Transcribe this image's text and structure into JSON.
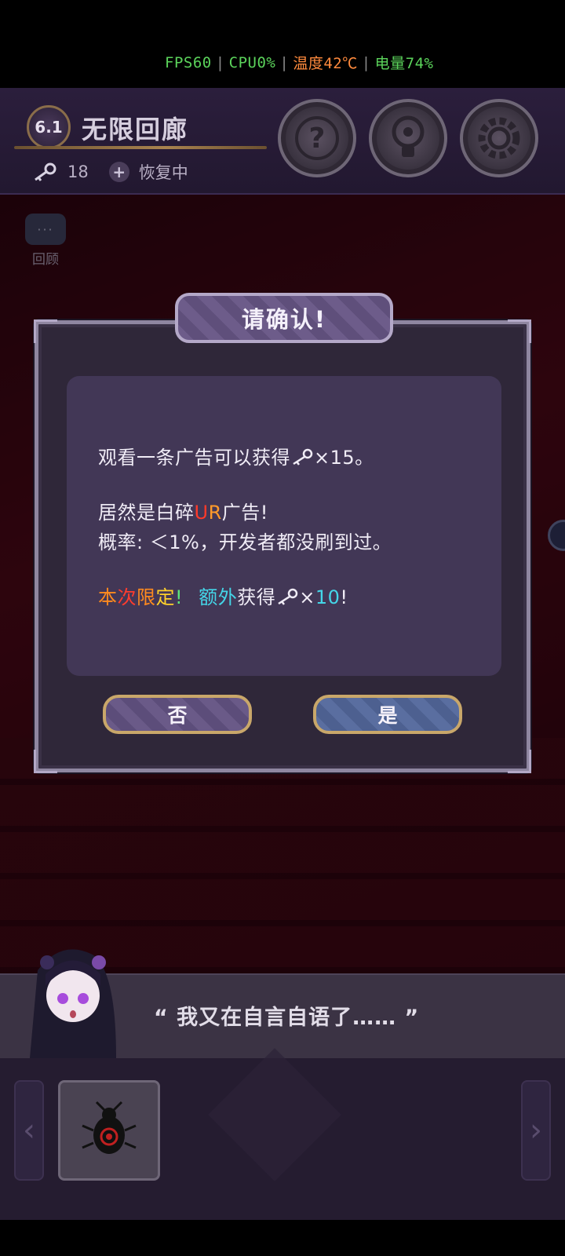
{
  "status_bar": {
    "fps": "FPS60",
    "cpu": "CPU0%",
    "temp": "温度42℃",
    "battery": "电量74%",
    "colors": {
      "fps": "#5bd35b",
      "temp": "#ff8a3d",
      "battery": "#5bd35b"
    }
  },
  "header": {
    "level": "6.1",
    "title": "无限回廊",
    "keys": "18",
    "recover_label": "恢复中",
    "icons": [
      "help-icon",
      "hint-lightbulb-icon",
      "settings-gear-icon"
    ]
  },
  "review": {
    "label": "回顾",
    "bubble_text": "···"
  },
  "dialog": {
    "title": "请确认!",
    "line1_a": "观看一条广告可以获得",
    "line1_b": "×15。",
    "line2_a": "居然是白碎",
    "line2_u": "U",
    "line2_r": "R",
    "line2_b": "广告!",
    "line3": "概率: ＜1%，开发者都没刷到过。",
    "line4": {
      "c1": "本",
      "c2": "次",
      "c3": "限",
      "c4": "定",
      "c5": "!",
      "bonus_a": "额外",
      "bonus_b": "获得",
      "bonus_x": "×",
      "bonus_n": "10",
      "bonus_end": "!"
    },
    "no_label": "否",
    "yes_label": "是"
  },
  "speech": {
    "text": "“ 我又在自言自语了…… ”"
  },
  "inventory": {
    "left_arrow": "‹",
    "right_arrow": "›"
  }
}
